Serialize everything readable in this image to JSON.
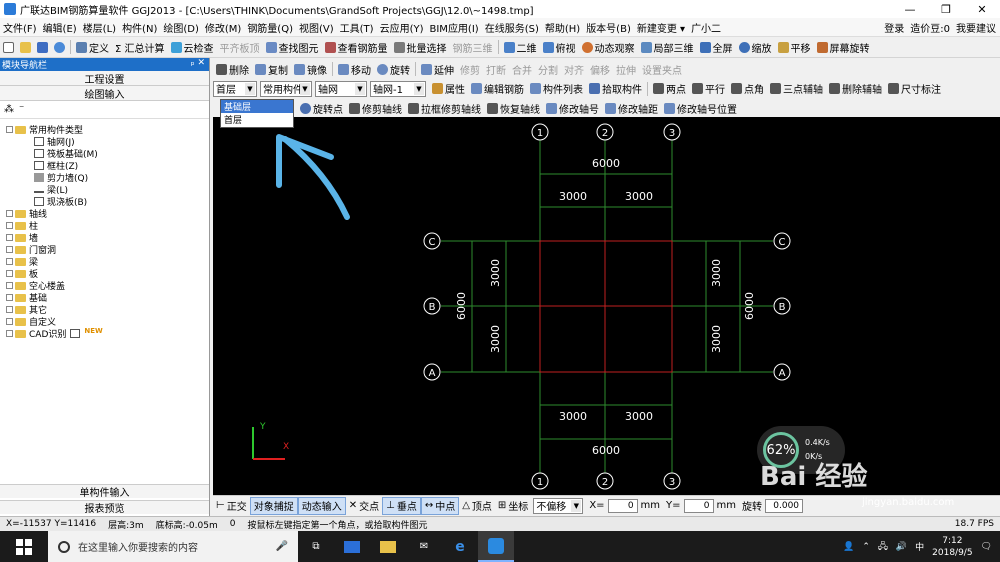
{
  "window": {
    "title": "广联达BIM钢筋算量软件 GGJ2013 - [C:\\Users\\THINK\\Documents\\GrandSoft Projects\\GGJ\\12.0\\~1498.tmp]",
    "controls": [
      "—",
      "❐",
      "✕"
    ]
  },
  "menubar": {
    "items": [
      "文件(F)",
      "编辑(E)",
      "楼层(L)",
      "构件(N)",
      "绘图(D)",
      "修改(M)",
      "钢筋量(Q)",
      "视图(V)",
      "工具(T)",
      "云应用(Y)",
      "BIM应用(I)",
      "在线服务(S)",
      "帮助(H)",
      "版本号(B)",
      "新建变更 ▾",
      "广小二"
    ],
    "right": {
      "login": "登录",
      "price": "造价豆:0",
      "help": "我要建议"
    }
  },
  "toolbar1": {
    "items": [
      "定义",
      "Σ 汇总计算",
      "云检查",
      "平齐板顶",
      "查找图元",
      "查看钢筋量",
      "批量选择",
      "钢筋三维",
      "二维",
      "俯视",
      "动态观察",
      "局部三维",
      "全屏",
      "缩放",
      "平移",
      "屏幕旋转"
    ]
  },
  "sidebar": {
    "header": "模块导航栏",
    "pins": "ₚ ✕",
    "btn_project": "工程设置",
    "btn_draw": "绘图输入",
    "tree": {
      "common_folder": "常用构件类型",
      "common_items": [
        "轴网(J)",
        "筏板基础(M)",
        "框柱(Z)",
        "剪力墙(Q)",
        "梁(L)",
        "现浇板(B)"
      ],
      "folders": [
        "轴线",
        "柱",
        "墙",
        "门窗洞",
        "梁",
        "板",
        "空心楼盖",
        "基础",
        "其它",
        "自定义",
        "CAD识别"
      ],
      "new_badge": "NEW"
    },
    "btn_single": "单构件输入",
    "btn_report": "报表预览"
  },
  "toolbar2": {
    "items": [
      "删除",
      "复制",
      "镜像",
      "移动",
      "旋转",
      "延伸",
      "修剪",
      "打断",
      "合并",
      "分割",
      "对齐",
      "偏移",
      "拉伸",
      "设置夹点"
    ]
  },
  "toolbar3": {
    "floor": "首层",
    "category": "常用构件",
    "type": "轴网",
    "instance": "轴网-1",
    "items": [
      "属性",
      "编辑钢筋",
      "构件列表",
      "拾取构件",
      "两点",
      "平行",
      "点角",
      "三点辅轴",
      "删除辅轴",
      "尺寸标注"
    ]
  },
  "floor_dropdown": {
    "options": [
      "基础层",
      "首层"
    ],
    "selected": 0
  },
  "toolbar4": {
    "items": [
      "旋转点",
      "修剪轴线",
      "拉框修剪轴线",
      "恢复轴线",
      "修改轴号",
      "修改轴距",
      "修改轴号位置"
    ]
  },
  "grid": {
    "x_axes": [
      "1",
      "2",
      "3"
    ],
    "y_axes": [
      "A",
      "B",
      "C"
    ],
    "top_total": "6000",
    "top_spans": [
      "3000",
      "3000"
    ],
    "bottom_total": "6000",
    "bottom_spans": [
      "3000",
      "3000"
    ],
    "left_total": "6000",
    "left_spans": [
      "3000",
      "3000"
    ],
    "right_total": "6000",
    "right_spans": [
      "3000",
      "3000"
    ],
    "ucs_y": "Y",
    "ucs_x": "X"
  },
  "bottombar": {
    "items": [
      "正交",
      "对象捕捉",
      "动态输入",
      "交点",
      "垂点",
      "中点",
      "顶点",
      "坐标"
    ],
    "offset_mode": "不偏移",
    "x_label": "X=",
    "x_value": "0",
    "unit1": "mm",
    "y_label": "Y=",
    "y_value": "0",
    "unit2": "mm",
    "rotate_label": "旋转",
    "rotate_value": "0.000"
  },
  "status": {
    "coords": "X=-11537  Y=11416",
    "floor_h": "层高:3m",
    "bottom_h": "底标高:-0.05m",
    "count": "0",
    "hint": "按鼠标左键指定第一个角点，或拾取构件图元",
    "fps": "18.7 FPS"
  },
  "overlay": {
    "speed_percent": "62%",
    "up_rate": "0.4K/s",
    "down_rate": "0K/s",
    "watermark": "Bai 经验",
    "watermark_sub": "jingyan.baidu.com"
  },
  "taskbar": {
    "search_placeholder": "在这里输入你要搜索的内容",
    "time": "7:12",
    "date": "2018/9/5",
    "lang": "中"
  },
  "colors": {
    "canvas_bg": "#000000",
    "grid_line": "#2e8b2e",
    "grid_center": "#c02020",
    "axis_text": "#ffffff",
    "annotation_arrow": "#5ab4e8"
  }
}
